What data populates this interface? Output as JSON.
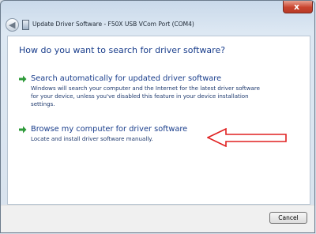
{
  "window": {
    "title": "Update Driver Software - F50X USB VCom Port (COM4)",
    "close_label": "x"
  },
  "content": {
    "heading": "How do you want to search for driver software?",
    "options": [
      {
        "title": "Search automatically for updated driver software",
        "description": "Windows will search your computer and the Internet for the latest driver software for your device, unless you've disabled this feature in your device installation settings."
      },
      {
        "title": "Browse my computer for driver software",
        "description": "Locate and install driver software manually."
      }
    ]
  },
  "footer": {
    "cancel_label": "Cancel"
  },
  "icons": {
    "back": "back-arrow-icon",
    "option_arrow": "green-arrow-icon",
    "annotation": "red-arrow-annotation"
  },
  "colors": {
    "heading": "#1a3e8c",
    "option_arrow": "#2e9a3a",
    "annotation": "#e02020",
    "close_button": "#c9452f"
  }
}
